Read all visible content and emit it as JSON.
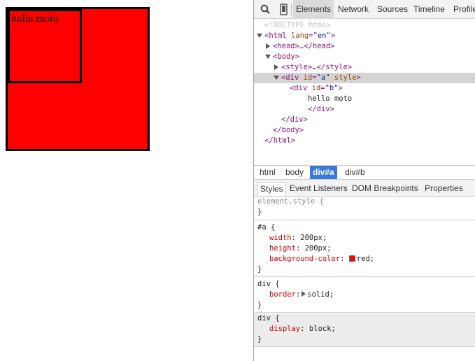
{
  "page": {
    "text_b": "hello moto",
    "box_color": "#ff0000",
    "border_color": "#000000"
  },
  "devtools": {
    "toolbar": {
      "search_icon": "search-icon",
      "device_icon": "device-mode-icon",
      "tabs": [
        "Elements",
        "Network",
        "Sources",
        "Timeline",
        "Profile"
      ]
    },
    "dom": {
      "doctype": "<!DOCTYPE html>",
      "html_open": "<html",
      "html_attr": "lang",
      "html_attr_val": "\"en\"",
      "gt": ">",
      "head": "<head>…</head>",
      "body_open": "<body>",
      "style": "<style>…</style>",
      "div_open": "<div",
      "id_attr": "id",
      "a_val": "\"a\"",
      "style_attr": "style",
      "b_val": "\"b\"",
      "text": "hello moto",
      "div_close": "</div>",
      "body_close": "</body>",
      "html_close": "</html>"
    },
    "breadcrumbs": [
      "html",
      "body",
      "div#a",
      "div#b"
    ],
    "subtabs": [
      "Styles",
      "Event Listeners",
      "DOM Breakpoints",
      "Properties"
    ],
    "styles": {
      "element_style": "element.style {",
      "close": "}",
      "rule_a_selector": "#a {",
      "width_prop": "width",
      "width_val": "200px;",
      "height_prop": "height",
      "height_val": "200px;",
      "bg_prop": "background-color",
      "bg_val": "red;",
      "swatch_color": "#ff0000",
      "div_selector": "div {",
      "border_prop": "border",
      "border_val": "solid;",
      "display_prop": "display",
      "display_val": "block;",
      "colon": ":"
    }
  }
}
